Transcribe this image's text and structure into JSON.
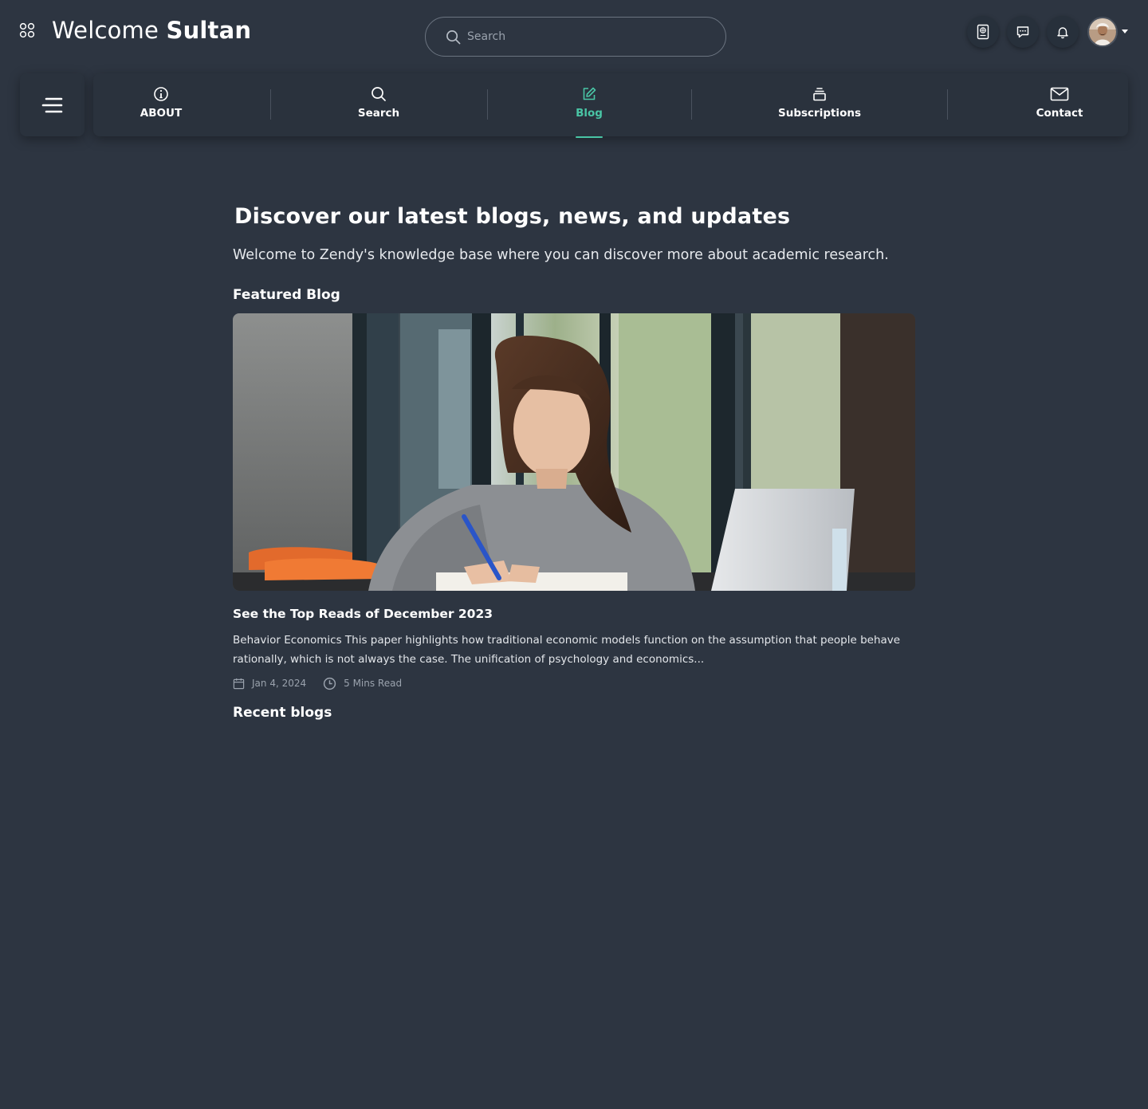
{
  "header": {
    "welcome_prefix": "Welcome",
    "user_name": "Sultan",
    "search": {
      "placeholder": "Search",
      "value": ""
    },
    "icons": [
      "apps-grid-icon",
      "passport-icon",
      "chat-icon",
      "bell-icon"
    ]
  },
  "nav": {
    "items": [
      {
        "label": "ABOUT",
        "icon": "info-icon"
      },
      {
        "label": "Search",
        "icon": "search-icon"
      },
      {
        "label": "Blog",
        "icon": "edit-icon",
        "active": true
      },
      {
        "label": "Subscriptions",
        "icon": "layers-icon"
      },
      {
        "label": "Contact",
        "icon": "mail-icon"
      }
    ]
  },
  "main": {
    "title": "Discover our latest blogs, news, and updates",
    "subtitle": "Welcome to Zendy's knowledge base where you can discover more about academic research.",
    "featured_heading": "Featured Blog",
    "featured": {
      "title": "See the Top Reads of December 2023",
      "excerpt": "Behavior Economics This paper highlights how traditional economic models function on the assumption that people behave rationally, which is not always the case. The unification of psychology and economics...",
      "date": "Jan 4, 2024",
      "read_time": "5 Mins Read"
    },
    "recent_heading": "Recent blogs"
  },
  "colors": {
    "background": "#2d3541",
    "panel": "#2a323d",
    "accent": "#49c5a5",
    "muted": "#9aa2ad"
  }
}
